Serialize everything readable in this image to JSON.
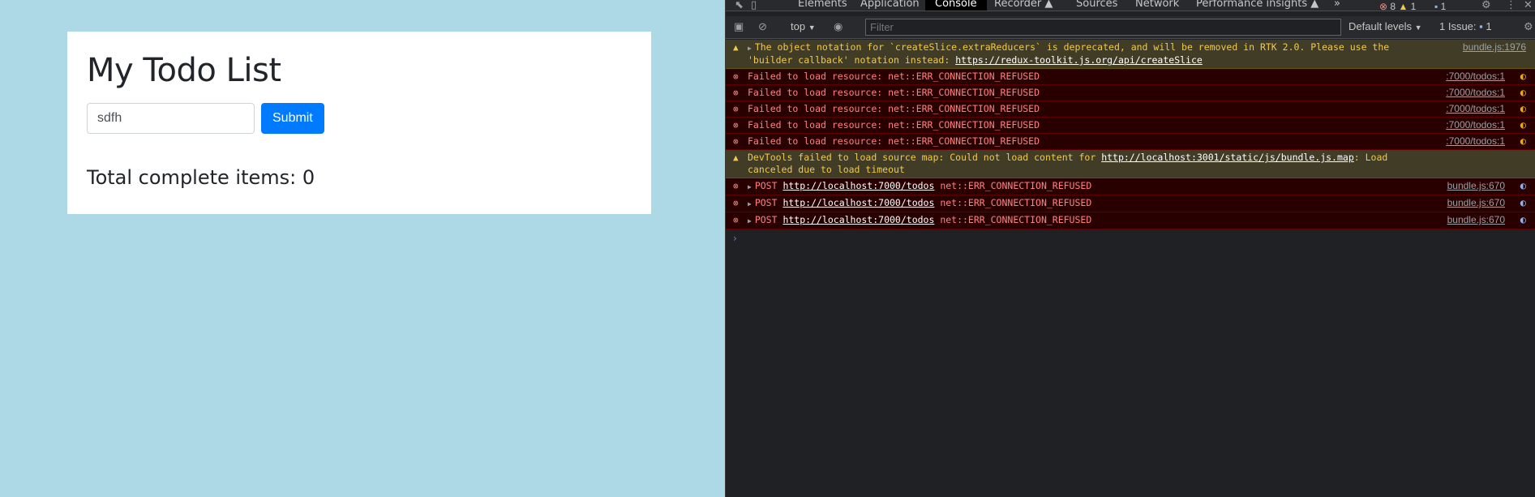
{
  "app": {
    "title": "My Todo List",
    "input_value": "sdfh",
    "submit_label": "Submit",
    "total_label": "Total complete items: 0"
  },
  "devtools": {
    "tabs": [
      "Elements",
      "Application",
      "Console",
      "Recorder ▲",
      "Sources",
      "Network",
      "Performance insights ▲"
    ],
    "active_tab": "Console",
    "more_tabs": "»",
    "badges": {
      "errors": "8",
      "warnings": "1",
      "messages": "1"
    },
    "toolbar": {
      "context": "top",
      "filter_placeholder": "Filter",
      "levels": "Default levels",
      "issues": "1 Issue:",
      "issue_count": "1"
    },
    "messages": [
      {
        "type": "warn",
        "text_before": "The object notation for `createSlice.extraReducers` is deprecated, and will be removed in RTK 2.0. Please use the 'builder callback' notation instead: ",
        "link": "https://redux-toolkit.js.org/api/createSlice",
        "text_after": "",
        "source": "bundle.js:1976"
      },
      {
        "type": "err",
        "text_before": "Failed to load resource: net::ERR_CONNECTION_REFUSED",
        "link": "",
        "text_after": "",
        "source": ":7000/todos:1"
      },
      {
        "type": "err",
        "text_before": "Failed to load resource: net::ERR_CONNECTION_REFUSED",
        "link": "",
        "text_after": "",
        "source": ":7000/todos:1"
      },
      {
        "type": "err",
        "text_before": "Failed to load resource: net::ERR_CONNECTION_REFUSED",
        "link": "",
        "text_after": "",
        "source": ":7000/todos:1"
      },
      {
        "type": "err",
        "text_before": "Failed to load resource: net::ERR_CONNECTION_REFUSED",
        "link": "",
        "text_after": "",
        "source": ":7000/todos:1"
      },
      {
        "type": "err",
        "text_before": "Failed to load resource: net::ERR_CONNECTION_REFUSED",
        "link": "",
        "text_after": "",
        "source": ":7000/todos:1"
      },
      {
        "type": "warn",
        "text_before": "DevTools failed to load source map: Could not load content for ",
        "link": "http://localhost:3001/static/js/bundle.js.map",
        "text_after": ": Load canceled due to load timeout",
        "source": ""
      },
      {
        "type": "err",
        "text_before": "POST ",
        "link": "http://localhost:7000/todos",
        "text_after": " net::ERR_CONNECTION_REFUSED",
        "source": "bundle.js:670"
      },
      {
        "type": "err",
        "text_before": "POST ",
        "link": "http://localhost:7000/todos",
        "text_after": " net::ERR_CONNECTION_REFUSED",
        "source": "bundle.js:670"
      },
      {
        "type": "err",
        "text_before": "POST ",
        "link": "http://localhost:7000/todos",
        "text_after": " net::ERR_CONNECTION_REFUSED",
        "source": "bundle.js:670"
      }
    ],
    "prompt": "›"
  },
  "colors": {
    "page_bg": "#add8e6",
    "primary": "#007bff",
    "console_bg": "#202124",
    "error_bg": "#290000",
    "warn_bg": "#413c26"
  }
}
